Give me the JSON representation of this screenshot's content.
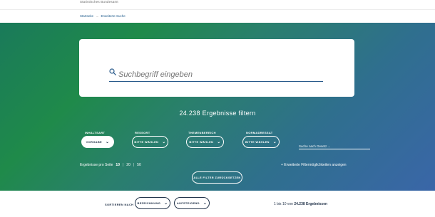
{
  "header": {
    "org_name": "Statistisches Bundesamt"
  },
  "breadcrumb": {
    "home": "Startseite",
    "separator": "→",
    "current": "Erweiterte Suche"
  },
  "search": {
    "placeholder": "Suchbegriff eingeben"
  },
  "results": {
    "count_text": "24.238 Ergebnisse filtern"
  },
  "filters": {
    "inhaltsart": {
      "label": "INHALTSART",
      "value": "VORGABE"
    },
    "ressort": {
      "label": "RESSORT",
      "value": "BITTE WÄHLEN"
    },
    "themenbereich": {
      "label": "THEMENBEREICH",
      "value": "BITTE WÄHLEN"
    },
    "normadressat": {
      "label": "NORMADRESSAT",
      "value": "BITTE WÄHLEN"
    },
    "gesetz": {
      "placeholder": "Suche nach Gesetz ..."
    }
  },
  "per_page": {
    "label": "Ergebnisse pro Seite",
    "options": [
      "10",
      "20",
      "50"
    ],
    "selected": "10",
    "divider": "|"
  },
  "extended_link": "+ Erweiterte Filtermöglichkeiten anzeigen",
  "reset_button": "ALLE FILTER ZURÜCKSETZEN",
  "sort": {
    "label": "SORTIEREN NACH",
    "field": "BEZEICHNUNG",
    "order": "AUFSTEIGEND"
  },
  "range": {
    "prefix": "1 bis 10 von",
    "total": "24.238 Ergebnissen"
  },
  "colors": {
    "brand_blue": "#28598a",
    "gradient_green": "#1f8a4a",
    "gradient_blue": "#3a66a8",
    "text_dark": "#22334a"
  },
  "icons": {
    "search": "search-icon",
    "chevron": "chevron-down-icon"
  }
}
